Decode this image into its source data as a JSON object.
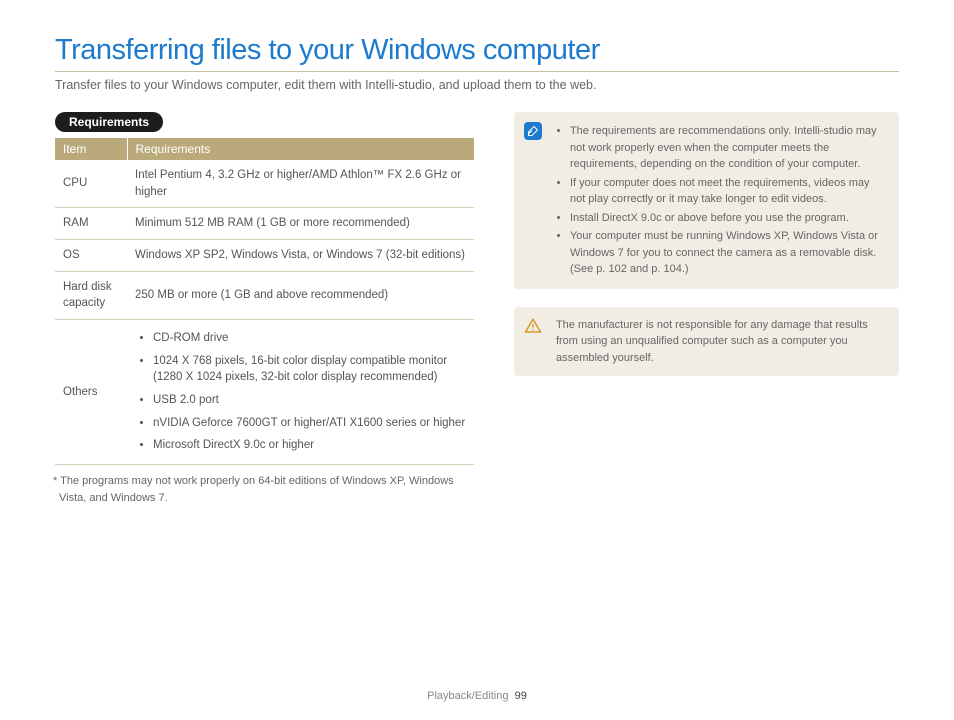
{
  "title": "Transferring files to your Windows computer",
  "intro": "Transfer files to your Windows computer, edit them with Intelli-studio, and upload them to the web.",
  "section_label": "Requirements",
  "table": {
    "head": {
      "c0": "Item",
      "c1": "Requirements"
    },
    "rows": [
      {
        "item": "CPU",
        "req": "Intel Pentium 4, 3.2 GHz or higher/AMD Athlon™ FX 2.6 GHz or higher"
      },
      {
        "item": "RAM",
        "req": "Minimum 512 MB RAM (1 GB or more recommended)"
      },
      {
        "item": "OS",
        "req": "Windows XP SP2, Windows Vista, or Windows 7 (32-bit editions)"
      },
      {
        "item": "Hard disk capacity",
        "req": "250 MB or more (1 GB and above recommended)"
      }
    ],
    "others_label": "Others",
    "others": [
      "CD-ROM drive",
      "1024 X 768 pixels, 16-bit color display compatible monitor (1280 X 1024 pixels, 32-bit color display recommended)",
      "USB 2.0 port",
      "nVIDIA Geforce 7600GT or higher/ATI X1600 series or higher",
      "Microsoft DirectX 9.0c or higher"
    ]
  },
  "footnote": "* The programs may not work properly on 64-bit editions of Windows XP, Windows Vista, and Windows 7.",
  "note_items": [
    "The requirements are recommendations only. Intelli-studio may not work properly even when the computer meets the requirements, depending on the condition of your computer.",
    "If your computer does not meet the requirements, videos may not play correctly or it may take longer to edit videos.",
    "Install DirectX 9.0c or above before you use the program.",
    "Your computer must be running Windows XP, Windows Vista or Windows 7 for you to connect the camera as a removable disk. (See p. 102 and p. 104.)"
  ],
  "warning": "The manufacturer is not responsible for any damage that results from using an unqualified computer such as a computer you assembled yourself.",
  "footer": {
    "section": "Playback/Editing",
    "page": "99"
  }
}
